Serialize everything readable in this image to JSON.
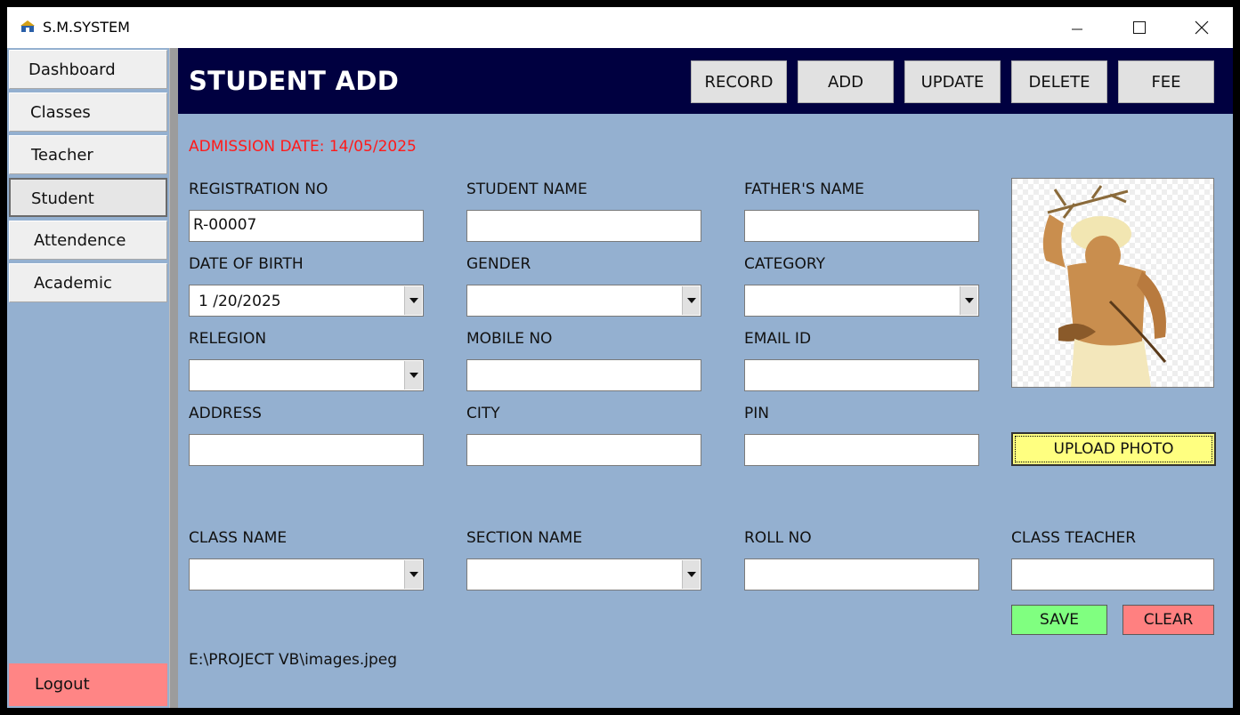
{
  "window": {
    "title": "S.M.SYSTEM"
  },
  "sidebar": {
    "items": [
      {
        "label": "Dashboard"
      },
      {
        "label": "Classes"
      },
      {
        "label": "Teacher"
      },
      {
        "label": "Student"
      },
      {
        "label": "Attendence"
      },
      {
        "label": "Academic"
      }
    ],
    "logout": "Logout"
  },
  "header": {
    "title": "STUDENT ADD",
    "buttons": [
      "RECORD",
      "ADD",
      "UPDATE",
      "DELETE",
      "FEE"
    ]
  },
  "form": {
    "admission_date": "ADMISSION DATE: 14/05/2025",
    "labels": {
      "registration_no": "REGISTRATION NO",
      "student_name": "STUDENT NAME",
      "fathers_name": "FATHER'S NAME",
      "date_of_birth": "DATE OF BIRTH",
      "gender": "GENDER",
      "category": "CATEGORY",
      "relegion": "RELEGION",
      "mobile_no": "MOBILE NO",
      "email_id": "EMAIL ID",
      "address": "ADDRESS",
      "city": "CITY",
      "pin": "PIN",
      "class_name": "CLASS NAME",
      "section_name": "SECTION NAME",
      "roll_no": "ROLL NO",
      "class_teacher": "CLASS TEACHER"
    },
    "values": {
      "registration_no": "R-00007",
      "date_of_birth": "1 /20/2025"
    },
    "upload_photo": "UPLOAD PHOTO",
    "save": "SAVE",
    "clear": "CLEAR",
    "photo_path": "E:\\PROJECT VB\\images.jpeg"
  },
  "colors": {
    "header_bg": "#000040",
    "panel_bg": "#94b0d0",
    "admission_text": "#ff1a1a",
    "upload_bg": "#ffff80",
    "save_bg": "#80ff80",
    "clear_bg": "#ff8080",
    "logout_bg": "#ff8585"
  }
}
